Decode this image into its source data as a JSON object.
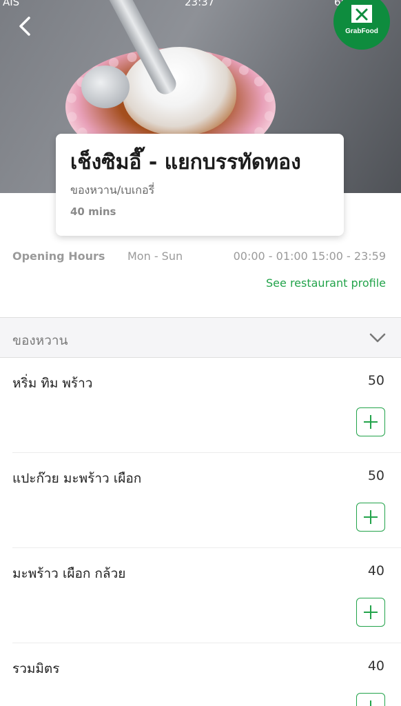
{
  "status_bar": {
    "carrier": "AIS",
    "time": "23:37",
    "battery": "65%"
  },
  "badge": {
    "label": "GrabFood"
  },
  "restaurant": {
    "name": "เช็งซิมอี๊ - แยกบรรทัดทอง",
    "category": "ของหวาน/เบเกอรี่",
    "eta": "40 mins"
  },
  "hours": {
    "label": "Opening Hours",
    "days": "Mon - Sun",
    "times": "00:00 - 01:00 15:00 - 23:59"
  },
  "profile_link": "See restaurant profile",
  "section": {
    "title": "ของหวาน"
  },
  "menu": [
    {
      "name": "หริ่ม ทิม พร้าว",
      "price": "50"
    },
    {
      "name": "แปะก๊วย มะพร้าว เผือก",
      "price": "50"
    },
    {
      "name": "มะพร้าว เผือก กล้วย",
      "price": "40"
    },
    {
      "name": "รวมมิตร",
      "price": "40"
    }
  ],
  "colors": {
    "brand_green": "#22a34a",
    "badge_green": "#0e8c3e"
  },
  "icons": [
    "back-chevron-icon",
    "grabfood-bag-icon",
    "chevron-down-icon",
    "plus-icon"
  ]
}
